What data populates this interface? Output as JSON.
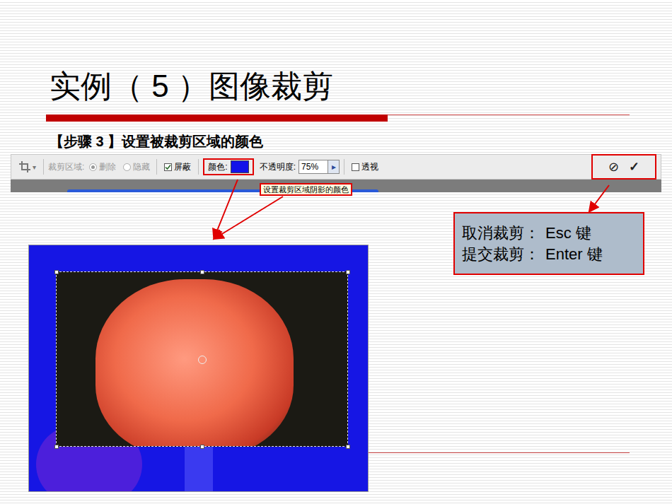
{
  "slide": {
    "title": "实例（ 5 ）图像裁剪",
    "step": "【步骤 3 】设置被裁剪区域的颜色"
  },
  "toolbar": {
    "tool_menu": "▾",
    "crop_area_label": "裁剪区域:",
    "crop_area_options": [
      {
        "label": "删除",
        "selected": true,
        "disabled": true
      },
      {
        "label": "隐藏",
        "selected": false,
        "disabled": true
      }
    ],
    "shield": {
      "label": "屏蔽",
      "checked": true
    },
    "color_label": "颜色:",
    "swatch_color": "#1212e8",
    "opacity_label": "不透明度:",
    "opacity_value": "75%",
    "opacity_button": "▸",
    "perspective": {
      "label": "透视",
      "checked": false
    },
    "cancel": "⊘",
    "commit": "✓"
  },
  "tooltip": "设置裁剪区域阴影的颜色",
  "callout": [
    {
      "action": "取消裁剪：",
      "key": "Esc 键"
    },
    {
      "action": "提交裁剪：",
      "key": "Enter 键"
    }
  ]
}
